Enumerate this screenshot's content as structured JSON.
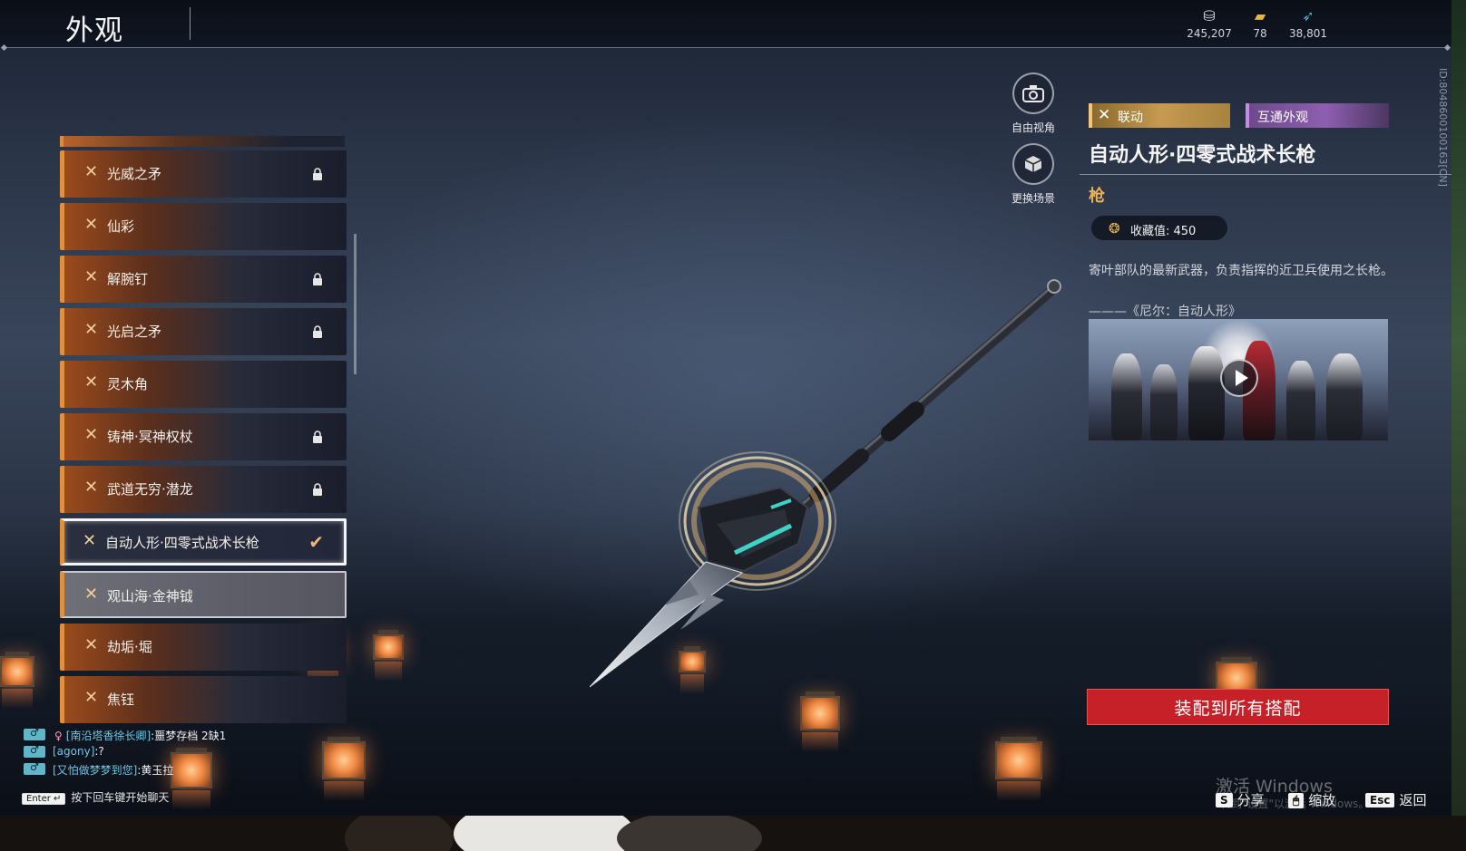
{
  "header": {
    "title": "外观",
    "currencies": [
      {
        "icon": "coin-stack-icon",
        "value": "245,207"
      },
      {
        "icon": "ticket-icon",
        "value": "78"
      },
      {
        "icon": "feather-icon",
        "value": "38,801"
      }
    ]
  },
  "list": {
    "items": [
      {
        "label": "光威之矛",
        "locked": true
      },
      {
        "label": "仙彩",
        "locked": false
      },
      {
        "label": "解腕钉",
        "locked": true
      },
      {
        "label": "光启之矛",
        "locked": true
      },
      {
        "label": "灵木角",
        "locked": false
      },
      {
        "label": "铸神·冥神权杖",
        "locked": true
      },
      {
        "label": "武道无穷·潜龙",
        "locked": true
      },
      {
        "label": "自动人形·四零式战术长枪",
        "locked": false,
        "state": "selected"
      },
      {
        "label": "观山海·金神钺",
        "locked": false,
        "state": "hovered"
      },
      {
        "label": "劫垢·堀",
        "locked": false
      },
      {
        "label": "焦钰",
        "locked": false
      }
    ]
  },
  "chat": {
    "lines": [
      {
        "name": "[南沿塔香徐长卿]",
        "msg": ":噩梦存档 2缺1"
      },
      {
        "name": "[agony]",
        "msg": ":?"
      },
      {
        "name": "[又怕做梦梦到您]",
        "msg": ":黄玉拉"
      }
    ],
    "enter_key": "Enter ↵",
    "enter_hint": "按下回车键开始聊天"
  },
  "view_controls": {
    "free_view": "自由视角",
    "change_scene": "更换场景"
  },
  "detail": {
    "tag_collab": "联动",
    "tag_shared": "互通外观",
    "title": "自动人形·四零式战术长枪",
    "type": "枪",
    "collect_label": "收藏值: 450",
    "description": "寄叶部队的最新武器，负责指挥的近卫兵使用之长枪。",
    "quote": "———《尼尔：自动人形》",
    "equip_button": "装配到所有搭配"
  },
  "side_id": "ID:8048600100163[CN]",
  "watermark": {
    "main": "激活 Windows",
    "sub": "转到\"设置\"以激活 Windows。"
  },
  "hints": [
    {
      "key": "S",
      "label": "分享"
    },
    {
      "key": "🖱",
      "label": "缩放"
    },
    {
      "key": "Esc",
      "label": "返回"
    }
  ],
  "colors": {
    "accent_orange": "#e0913f",
    "collab_gold": "#c79a50",
    "shared_purple": "#8e5fb0",
    "equip_red": "#c62128",
    "type_gold": "#e7b25a"
  }
}
